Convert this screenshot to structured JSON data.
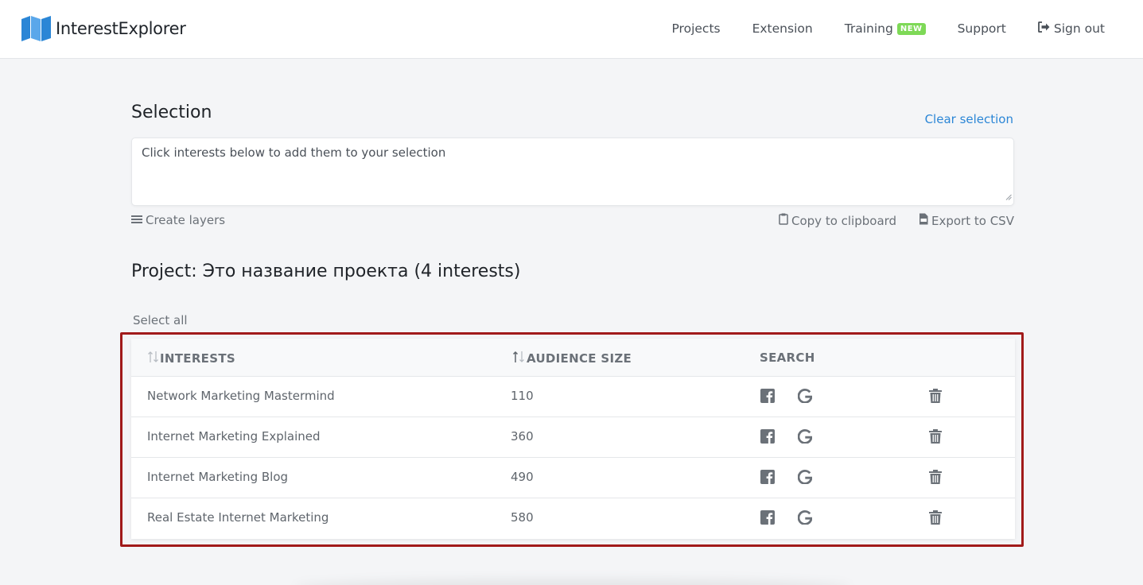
{
  "header": {
    "logo_text": "InterestExplorer",
    "nav": {
      "projects": "Projects",
      "extension": "Extension",
      "training": "Training",
      "training_badge": "NEW",
      "support": "Support",
      "signout": "Sign out"
    }
  },
  "selection": {
    "title": "Selection",
    "clear": "Clear selection",
    "placeholder": "Click interests below to add them to your selection",
    "create_layers": "Create layers",
    "copy": "Copy to clipboard",
    "export": "Export to CSV"
  },
  "project": {
    "title": "Project: Это название проекта (4 interests)",
    "select_all": "Select all"
  },
  "table": {
    "headers": {
      "interests": "INTERESTS",
      "audience": "AUDIENCE SIZE",
      "search": "SEARCH"
    },
    "rows": [
      {
        "name": "Network Marketing Mastermind",
        "size": "110"
      },
      {
        "name": "Internet Marketing Explained",
        "size": "360"
      },
      {
        "name": "Internet Marketing Blog",
        "size": "490"
      },
      {
        "name": "Real Estate Internet Marketing",
        "size": "580"
      }
    ]
  },
  "icons": [
    "map-logo-icon",
    "sign-out-icon",
    "list-icon",
    "clipboard-icon",
    "csv-file-icon",
    "sort-icon",
    "facebook-icon",
    "google-icon",
    "trash-icon"
  ],
  "colors": {
    "accent": "#2b86d6",
    "badge": "#7ed957",
    "highlight": "#a11a1a",
    "logo_blue": "#2b86d6"
  }
}
